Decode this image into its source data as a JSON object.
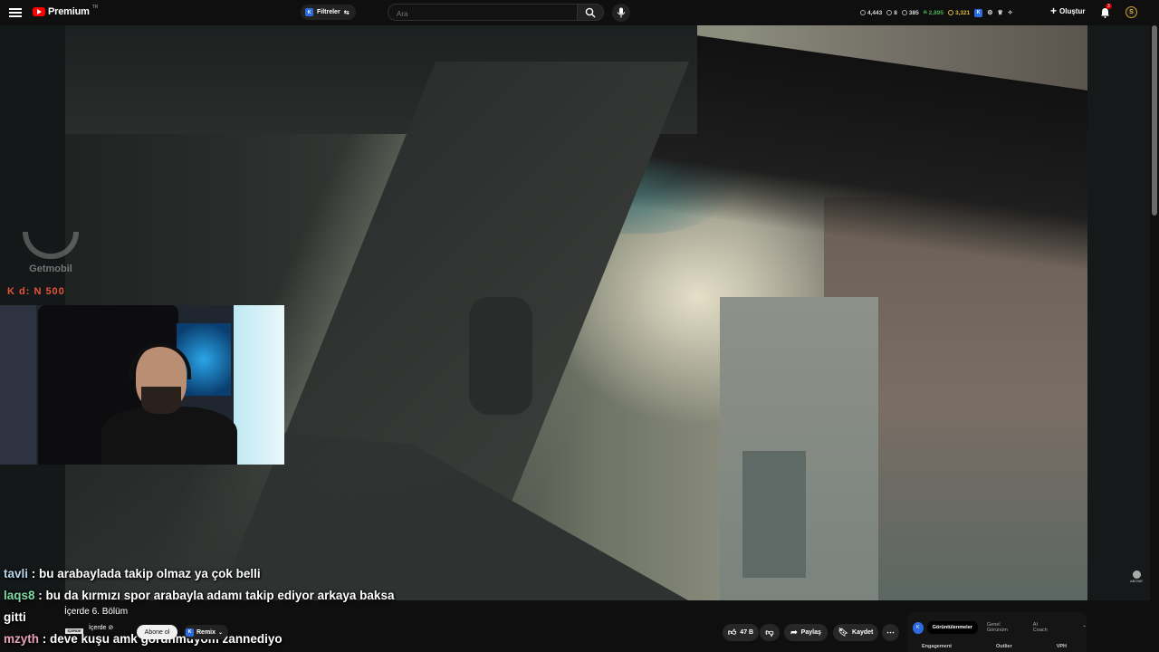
{
  "header": {
    "logo_text": "Premium",
    "logo_sup": "TR",
    "filters_label": "Filtreler",
    "search_placeholder": "Ara",
    "stats": [
      "4,443",
      "8",
      "385",
      "2,895",
      "3,321"
    ],
    "create_label": "Oluştur",
    "notification_count": "3",
    "avatar_letter": "S"
  },
  "overlay": {
    "watermark": "Getmobil",
    "hud_text": "K d: N 500"
  },
  "chat": [
    {
      "user": "tavli",
      "message": " : bu arabaylada takip olmaz ya çok belli"
    },
    {
      "user": "laqs8",
      "message": " : bu da kırmızı spor arabayla adamı takip ediyor arkaya baksa"
    },
    {
      "user": "",
      "message": "gitti"
    },
    {
      "user": "mzyth",
      "message": " : deve kuşu amk görünmüyom zannediyo"
    }
  ],
  "video": {
    "title": "İçerde 6. Bölüm",
    "channel_name": "İçerde ⊘",
    "channel_thumb": "İÇERDE",
    "subscribe_label": "Abone ol",
    "remix_label": "Remix",
    "like_count": "47 B",
    "share_label": "Paylaş",
    "save_label": "Kaydet"
  },
  "panel": {
    "tabs": [
      "Görüntülenmeler",
      "Genel Görünüm",
      "AI Coach"
    ],
    "columns": [
      "Engagement",
      "Outlier",
      "VPH"
    ]
  },
  "corner_label": "ABONE"
}
